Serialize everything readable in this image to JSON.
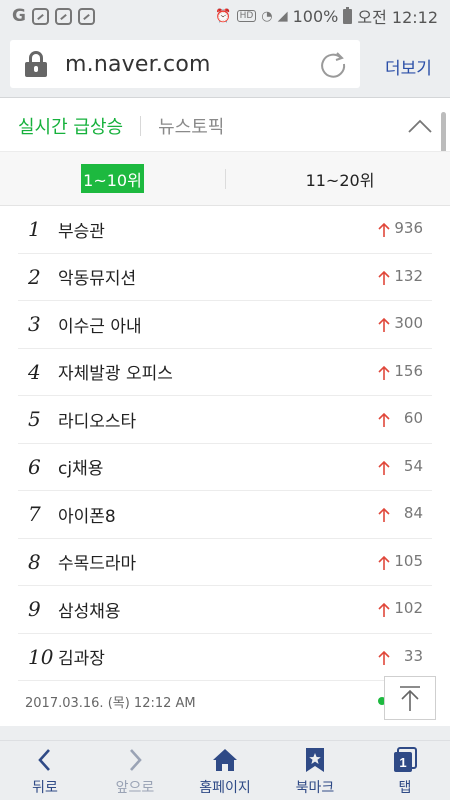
{
  "status_bar": {
    "battery": "100%",
    "time": "오전 12:12",
    "hd_badge": "HD"
  },
  "url_bar": {
    "url": "m.naver.com",
    "more_label": "더보기"
  },
  "topic_tabs": {
    "realtime_label": "실시간 급상승",
    "news_label": "뉴스토픽"
  },
  "range_tabs": {
    "first": "1~10위",
    "second": "11~20위"
  },
  "rankings": [
    {
      "rank": "1",
      "term": "부승관",
      "count": "936"
    },
    {
      "rank": "2",
      "term": "악동뮤지션",
      "count": "132"
    },
    {
      "rank": "3",
      "term": "이수근 아내",
      "count": "300"
    },
    {
      "rank": "4",
      "term": "자체발광 오피스",
      "count": "156"
    },
    {
      "rank": "5",
      "term": "라디오스타",
      "count": "60"
    },
    {
      "rank": "6",
      "term": "cj채용",
      "count": "54"
    },
    {
      "rank": "7",
      "term": "아이폰8",
      "count": "84"
    },
    {
      "rank": "8",
      "term": "수목드라마",
      "count": "105"
    },
    {
      "rank": "9",
      "term": "삼성채용",
      "count": "102"
    },
    {
      "rank": "10",
      "term": "김과장",
      "count": "33"
    }
  ],
  "timestamp": "2017.03.16. (목) 12:12 AM",
  "bottom_nav": {
    "back": "뒤로",
    "forward": "앞으로",
    "home": "홈페이지",
    "bookmark": "북마크",
    "tabs": "탭",
    "tab_count": "1"
  },
  "colors": {
    "accent_green": "#1db93f",
    "link_blue": "#2b4fa8",
    "nav_blue": "#2f4a86",
    "rise_red": "#e0483b"
  },
  "icons": [
    "lock-icon",
    "reload-icon",
    "chevron-up-icon",
    "up-arrow-icon",
    "scroll-top-icon",
    "back-icon",
    "forward-icon",
    "home-icon",
    "bookmark-icon",
    "tabs-icon"
  ]
}
